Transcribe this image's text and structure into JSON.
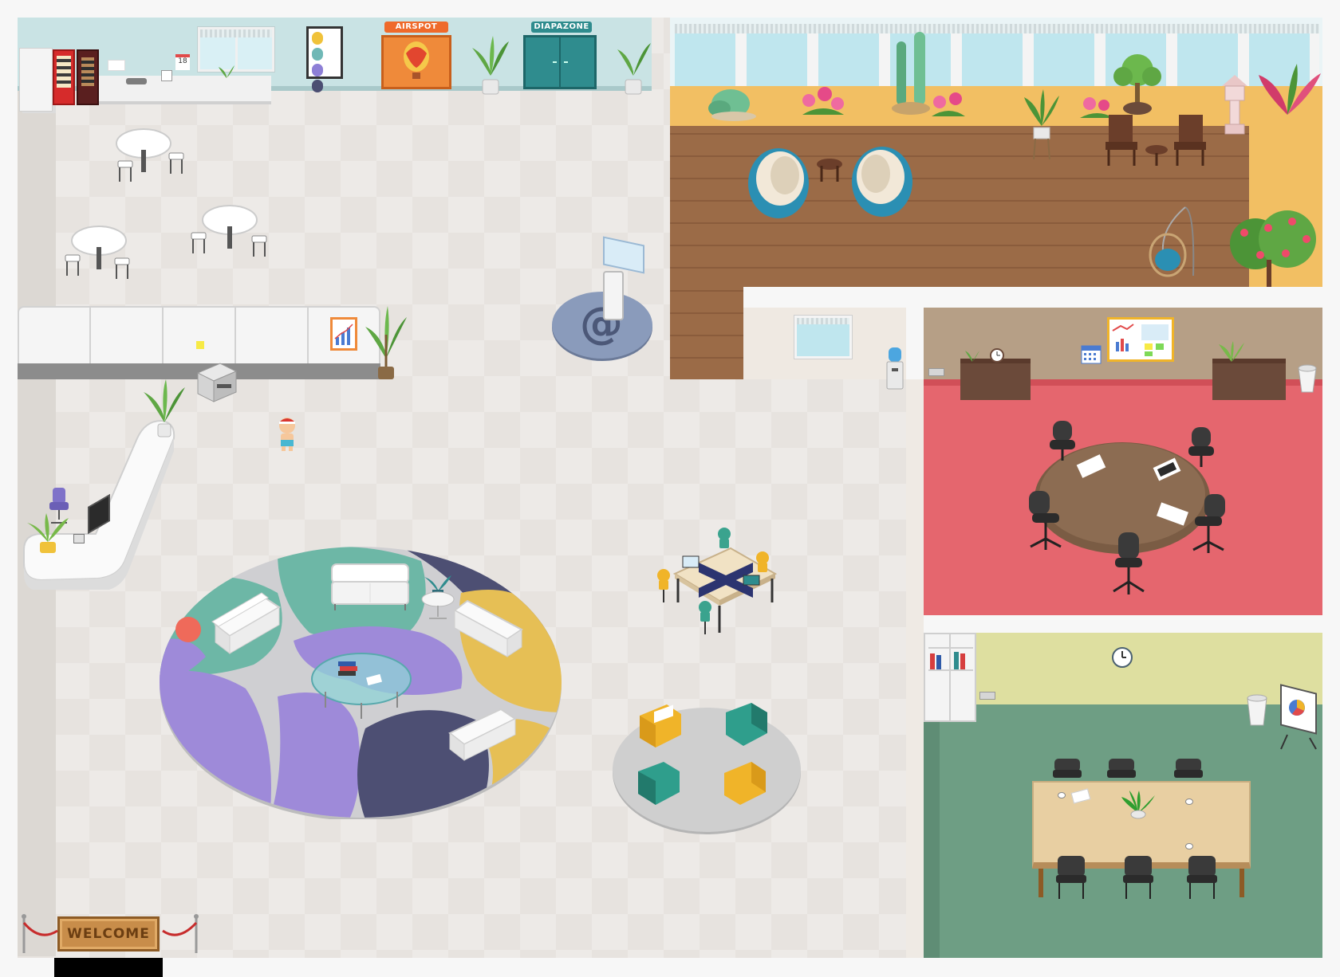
{
  "signs": {
    "airspot": "AIRSPOT",
    "diapazone": "DIAPAZONE",
    "welcome": "WELCOME",
    "calendar_day": "18"
  },
  "icons": {
    "info_desk": "at-sign-icon",
    "clock": "clock-icon",
    "avatar": "player-avatar"
  },
  "colors": {
    "floor": "#e7e3df",
    "wall_teal": "#c9e3e4",
    "terrace_wood": "#9b6b47",
    "terrace_sand": "#f2bf63",
    "meeting_red": "#e5666e",
    "meeting_wall": "#b69f86",
    "conf_green": "#6e9e84",
    "conf_wall": "#dedfa0",
    "rug_purple": "#9e8ad9",
    "rug_teal": "#6db7a6",
    "rug_yellow": "#e6bf55",
    "rug_navy": "#4d4f73",
    "accent_orange": "#ef8a3a",
    "door_teal": "#2f8c8e"
  }
}
